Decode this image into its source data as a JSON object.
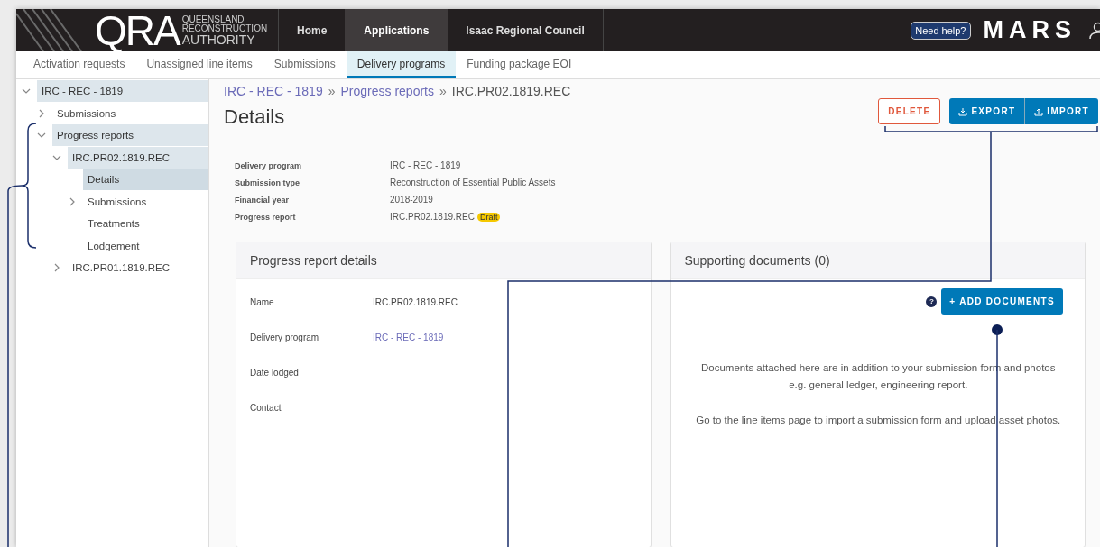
{
  "header": {
    "logo_mark": "QRA",
    "logo_lines": [
      "QUEENSLAND",
      "RECONSTRUCTION",
      "AUTHORITY"
    ],
    "nav": [
      {
        "label": "Home",
        "selected": false
      },
      {
        "label": "Applications",
        "selected": true
      },
      {
        "label": "Isaac Regional Council",
        "selected": false
      }
    ],
    "help_button": "Need help?",
    "brand": "MARS"
  },
  "subnav": [
    {
      "label": "Activation requests",
      "selected": false
    },
    {
      "label": "Unassigned line items",
      "selected": false
    },
    {
      "label": "Submissions",
      "selected": false
    },
    {
      "label": "Delivery programs",
      "selected": true
    },
    {
      "label": "Funding package EOI",
      "selected": false
    }
  ],
  "tree": [
    {
      "label": "IRC - REC - 1819",
      "expanded": true,
      "highlighted": true,
      "selected": false,
      "children": [
        {
          "label": "Submissions",
          "expanded": false,
          "highlighted": false,
          "selected": false
        },
        {
          "label": "Progress reports",
          "expanded": true,
          "highlighted": true,
          "selected": false,
          "children": [
            {
              "label": "IRC.PR02.1819.REC",
              "expanded": true,
              "highlighted": true,
              "selected": false,
              "children": [
                {
                  "label": "Details",
                  "highlighted": true,
                  "selected": true
                },
                {
                  "label": "Submissions",
                  "expanded": false,
                  "highlighted": false,
                  "selected": false
                },
                {
                  "label": "Treatments",
                  "highlighted": false,
                  "selected": false
                },
                {
                  "label": "Lodgement",
                  "highlighted": false,
                  "selected": false
                }
              ]
            },
            {
              "label": "IRC.PR01.1819.REC",
              "expanded": false,
              "highlighted": false,
              "selected": false
            }
          ]
        }
      ]
    }
  ],
  "breadcrumb": [
    {
      "label": "IRC - REC - 1819",
      "kind": "link"
    },
    {
      "label": "Progress reports",
      "kind": "link"
    },
    {
      "label": "IRC.PR02.1819.REC",
      "kind": "current"
    }
  ],
  "breadcrumb_separator": "»",
  "title": "Details",
  "actions": [
    {
      "label": "DELETE",
      "kind": "danger"
    },
    {
      "label": "EXPORT",
      "kind": "export"
    },
    {
      "label": "IMPORT",
      "kind": "import"
    }
  ],
  "summary": [
    {
      "label": "Delivery program",
      "value": "IRC - REC - 1819"
    },
    {
      "label": "Submission type",
      "value": "Reconstruction of Essential Public Assets"
    },
    {
      "label": "Financial year",
      "value": "2018-2019"
    },
    {
      "label": "Progress report",
      "value": "IRC.PR02.1819.REC",
      "badge": "Draft"
    }
  ],
  "details_card": {
    "title": "Progress report details",
    "fields": [
      {
        "label": "Name",
        "value": "IRC.PR02.1819.REC",
        "kind": "text"
      },
      {
        "label": "Delivery program",
        "value": "IRC - REC - 1819",
        "kind": "link"
      },
      {
        "label": "Date lodged",
        "kind": "text"
      },
      {
        "label": "Contact",
        "kind": "text"
      }
    ]
  },
  "documents_card": {
    "title": "Supporting documents (0)",
    "help_icon": "?",
    "add_button": "+ ADD DOCUMENTS",
    "notes": [
      "Documents attached here are in addition to your submission form and photos e.g. general ledger, engineering report.",
      "Go to the line items page to import a submission form and upload asset photos."
    ]
  }
}
